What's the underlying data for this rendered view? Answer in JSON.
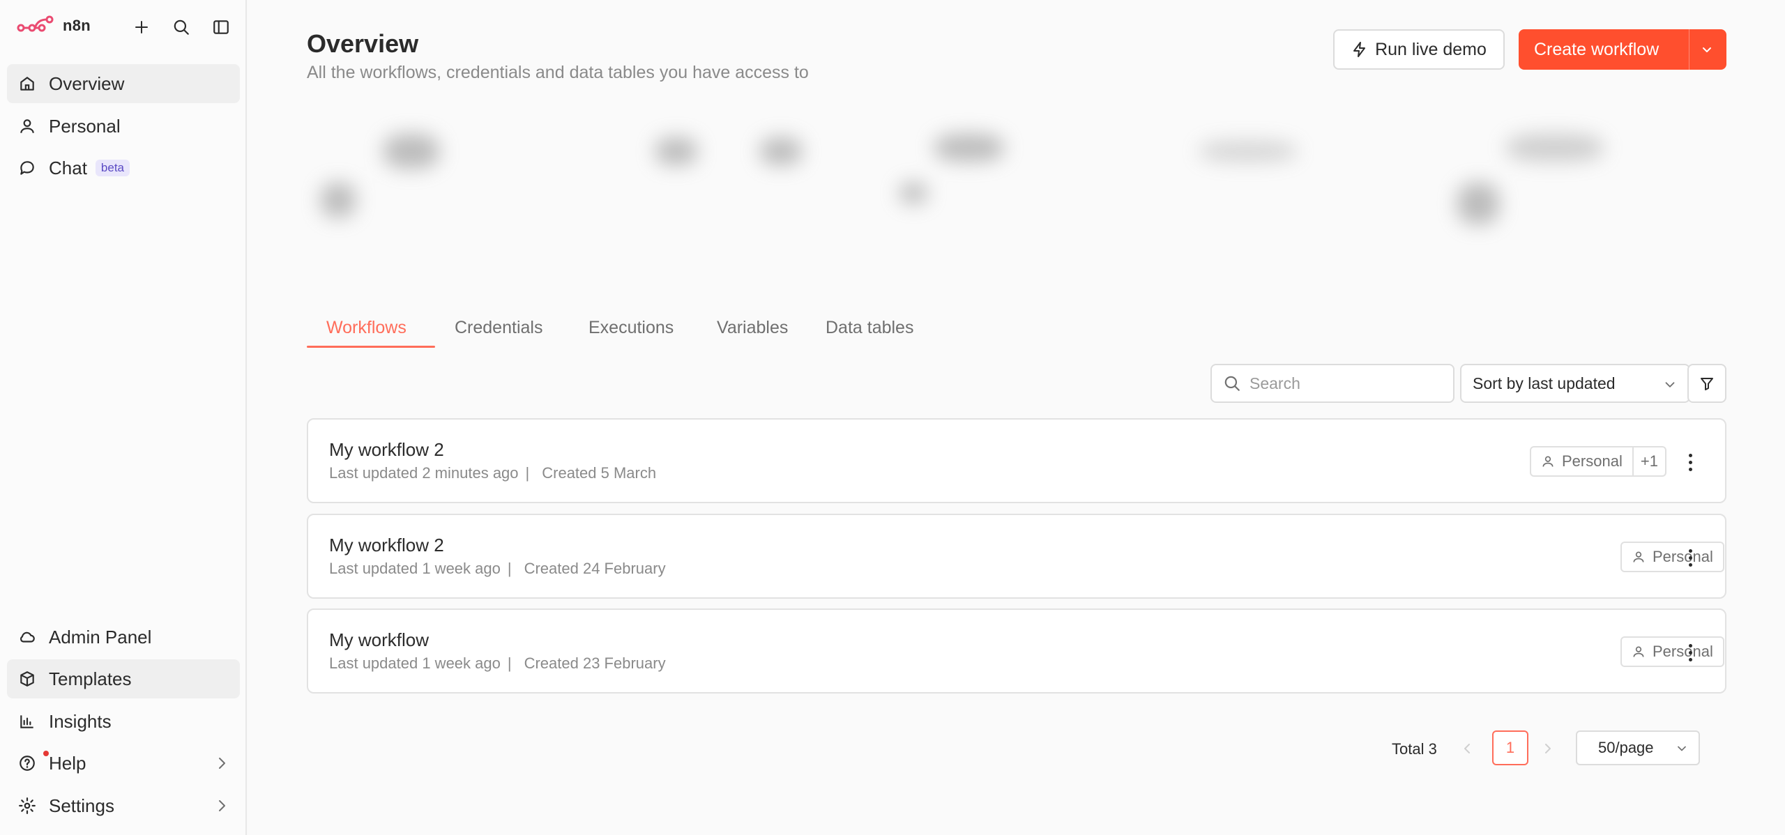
{
  "app": {
    "name": "n8n",
    "accent": "#ff4f2e",
    "tab_accent": "#ff6d5a"
  },
  "sidebar": {
    "top_icons": [
      "plus-icon",
      "search-icon",
      "sidebar-toggle-icon"
    ],
    "items": [
      {
        "label": "Overview",
        "icon": "home-icon"
      },
      {
        "label": "Personal",
        "icon": "user-icon"
      },
      {
        "label": "Chat",
        "icon": "chat-icon",
        "badge": "beta"
      }
    ],
    "bottom_items": [
      {
        "label": "Admin Panel",
        "icon": "cloud-icon"
      },
      {
        "label": "Templates",
        "icon": "box-icon"
      },
      {
        "label": "Insights",
        "icon": "bar-chart-icon"
      },
      {
        "label": "Help",
        "icon": "help-icon"
      },
      {
        "label": "Settings",
        "icon": "gear-icon"
      }
    ]
  },
  "header": {
    "title": "Overview",
    "subtitle": "All the workflows, credentials and data tables you have access to",
    "demo_button": "Run live demo",
    "create_button": "Create workflow"
  },
  "tabs": [
    {
      "label": "Workflows",
      "active": true
    },
    {
      "label": "Credentials"
    },
    {
      "label": "Executions"
    },
    {
      "label": "Variables"
    },
    {
      "label": "Data tables"
    }
  ],
  "toolbar": {
    "search_placeholder": "Search",
    "sort_value": "Sort by last updated"
  },
  "workflows": [
    {
      "name": "My workflow 2",
      "updated": "Last updated 2 minutes ago",
      "created": "Created 5 March",
      "owner": "Personal",
      "extra": "+1"
    },
    {
      "name": "My workflow 2",
      "updated": "Last updated 1 week ago",
      "created": "Created 24 February",
      "owner": "Personal"
    },
    {
      "name": "My workflow",
      "updated": "Last updated 1 week ago",
      "created": "Created 23 February",
      "owner": "Personal"
    }
  ],
  "pagination": {
    "total": "Total 3",
    "current_page": "1",
    "per_page": "50/page"
  }
}
